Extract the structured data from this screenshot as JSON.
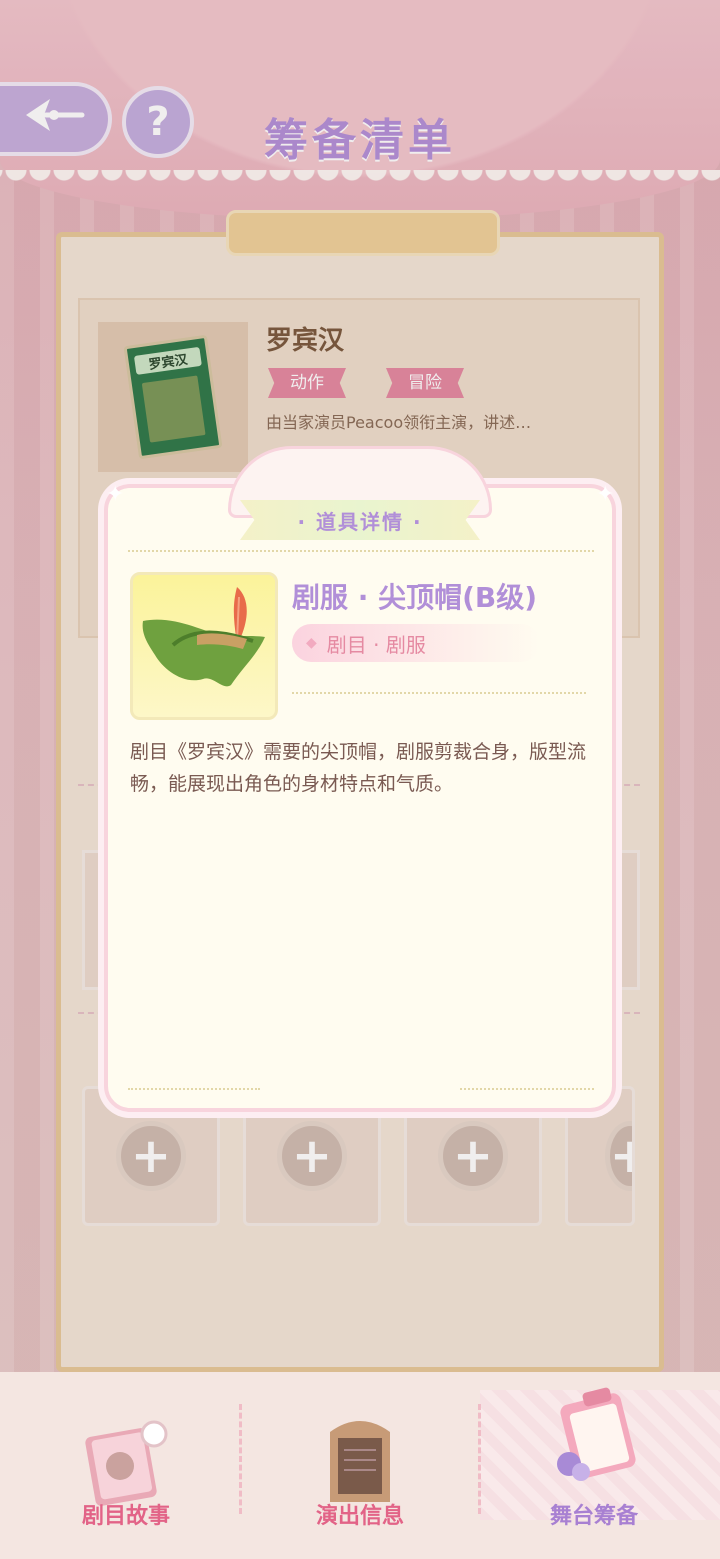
{
  "header": {
    "title": "筹备清单",
    "help_label": "?"
  },
  "script": {
    "name": "罗宾汉",
    "cover_label": "罗宾汉",
    "tags": [
      "动作",
      "冒险"
    ],
    "description": "由当家演员Peacoo领衔主演，讲述…"
  },
  "popup": {
    "title": "· 道具详情 ·",
    "item_name": "剧服 · 尖顶帽(B级)",
    "item_type": "剧目 · 剧服",
    "item_description": "剧目《罗宾汉》需要的尖顶帽，剧服剪裁合身，版型流畅，能展现出角色的身材特点和气质。"
  },
  "slots": {
    "add_symbol": "+"
  },
  "bottom_nav": {
    "items": [
      {
        "label": "剧目故事",
        "active": false
      },
      {
        "label": "演出信息",
        "active": false
      },
      {
        "label": "舞台筹备",
        "active": true
      }
    ]
  },
  "colors": {
    "accent_purple": "#b18fd8",
    "accent_pink": "#e58aa2",
    "nav_inactive": "#e26387",
    "nav_active": "#a880d2"
  }
}
